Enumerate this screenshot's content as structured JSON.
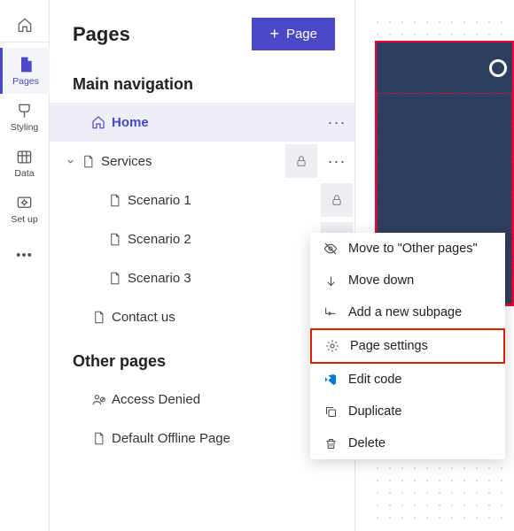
{
  "rail": {
    "home": "Home",
    "items": [
      {
        "label": "Pages"
      },
      {
        "label": "Styling"
      },
      {
        "label": "Data"
      },
      {
        "label": "Set up"
      },
      {
        "label": "More"
      }
    ]
  },
  "panel": {
    "title": "Pages",
    "addButton": "Page",
    "sections": {
      "main": "Main navigation",
      "other": "Other pages"
    },
    "tree": {
      "home": "Home",
      "services": "Services",
      "scenario1": "Scenario 1",
      "scenario2": "Scenario 2",
      "scenario3": "Scenario 3",
      "contact": "Contact us",
      "accessDenied": "Access Denied",
      "offline": "Default Offline Page"
    }
  },
  "contextMenu": {
    "moveTo": "Move to \"Other pages\"",
    "moveDown": "Move down",
    "addSub": "Add a new subpage",
    "settings": "Page settings",
    "editCode": "Edit code",
    "duplicate": "Duplicate",
    "delete": "Delete"
  }
}
